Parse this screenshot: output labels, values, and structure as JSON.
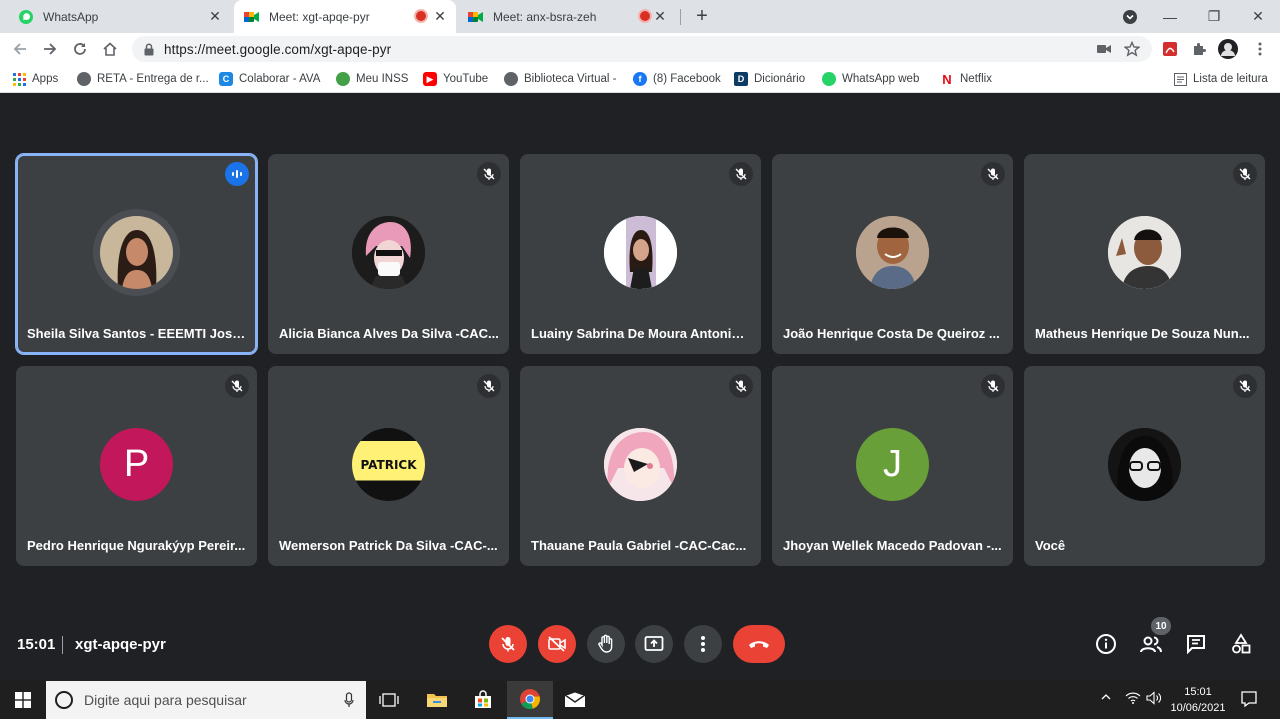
{
  "tabs": [
    {
      "title": "WhatsApp",
      "close": "✕"
    },
    {
      "title": "Meet: xgt-apqe-pyr",
      "close": "✕"
    },
    {
      "title": "Meet: anx-bsra-zeh",
      "close": "✕"
    }
  ],
  "new_tab": "+",
  "window": {
    "minimize": "—",
    "maximize": "❐",
    "close": "✕"
  },
  "address": {
    "url": "https://meet.google.com/xgt-apqe-pyr"
  },
  "bookmarks": [
    {
      "label": "Apps",
      "icon": "apps-grid-icon"
    },
    {
      "label": "RETA - Entrega de r...",
      "icon": "globe-icon"
    },
    {
      "label": "Colaborar - AVA",
      "icon": "colaborar-icon"
    },
    {
      "label": "Meu INSS",
      "icon": "inss-icon"
    },
    {
      "label": "YouTube",
      "icon": "youtube-icon"
    },
    {
      "label": "Biblioteca Virtual -",
      "icon": "globe-icon"
    },
    {
      "label": "(8) Facebook",
      "icon": "facebook-icon"
    },
    {
      "label": "Dicionário",
      "icon": "dicionario-icon"
    },
    {
      "label": "WhatsApp web",
      "icon": "whatsapp-icon"
    },
    {
      "label": "Netflix",
      "icon": "netflix-icon"
    },
    {
      "label": "Lista de leitura",
      "icon": "reading-list-icon"
    }
  ],
  "participants": [
    {
      "name": "Sheila Silva Santos - EEEMTI Josin...",
      "speaking": true,
      "avatar_color": "#5f6368",
      "letter": ""
    },
    {
      "name": "Alicia Bianca Alves Da Silva -CAC...",
      "speaking": false,
      "avatar_color": "#e8a0c0",
      "letter": ""
    },
    {
      "name": "Luainy Sabrina De Moura Antonio ...",
      "speaking": false,
      "avatar_color": "#ffffff",
      "letter": ""
    },
    {
      "name": "João Henrique Costa De Queiroz ...",
      "speaking": false,
      "avatar_color": "#c49a7a",
      "letter": ""
    },
    {
      "name": "Matheus Henrique De Souza Nun...",
      "speaking": false,
      "avatar_color": "#d8d4d0",
      "letter": ""
    },
    {
      "name": "Pedro Henrique Ngurakýyp Pereir...",
      "speaking": false,
      "avatar_color": "#c2185b",
      "letter": "P"
    },
    {
      "name": "Wemerson Patrick Da Silva -CAC-...",
      "speaking": false,
      "avatar_color": "#fff176",
      "letter": "PATRICK"
    },
    {
      "name": "Thauane Paula Gabriel -CAC-Cac...",
      "speaking": false,
      "avatar_color": "#f8d7e0",
      "letter": ""
    },
    {
      "name": "Jhoyan Wellek Macedo Padovan -...",
      "speaking": false,
      "avatar_color": "#689f38",
      "letter": "J"
    },
    {
      "name": "Você",
      "speaking": false,
      "avatar_color": "#1a1a1a",
      "letter": ""
    }
  ],
  "meeting": {
    "time": "15:01",
    "code": "xgt-apqe-pyr",
    "participant_count": "10"
  },
  "taskbar": {
    "search_placeholder": "Digite aqui para pesquisar",
    "time": "15:01",
    "date": "10/06/2021"
  }
}
